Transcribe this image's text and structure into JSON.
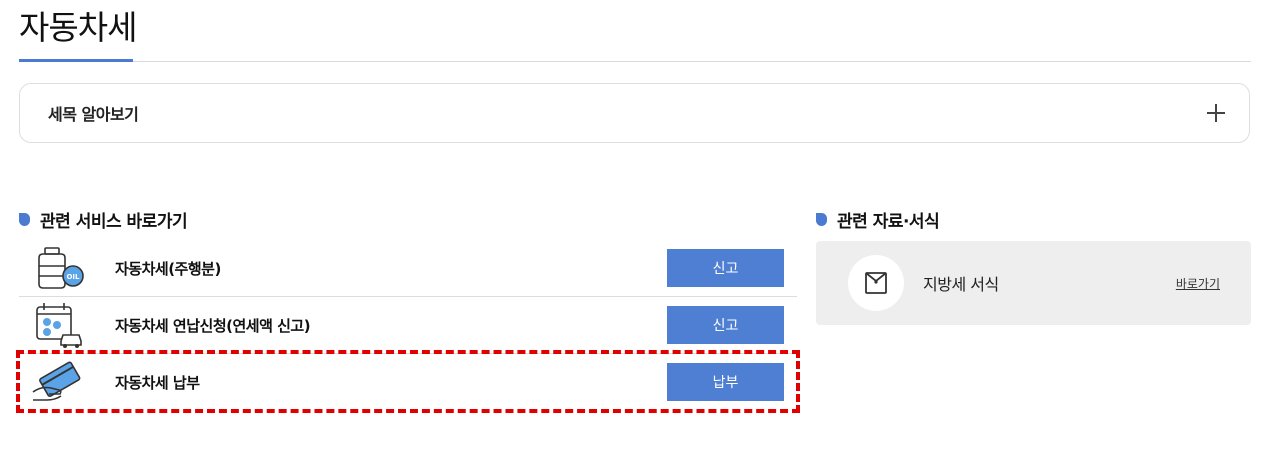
{
  "page": {
    "title": "자동차세"
  },
  "accordion": {
    "label": "세목 알아보기",
    "icon": "plus-icon"
  },
  "services": {
    "heading": "관련 서비스 바로가기",
    "items": [
      {
        "label": "자동차세(주행분)",
        "button": "신고",
        "icon": "oil-tank-icon"
      },
      {
        "label": "자동차세 연납신청(연세액 신고)",
        "button": "신고",
        "icon": "calendar-car-icon"
      },
      {
        "label": "자동차세 납부",
        "button": "납부",
        "icon": "card-payment-icon",
        "highlighted": true
      }
    ]
  },
  "documents": {
    "heading": "관련 자료·서식",
    "items": [
      {
        "title": "지방세 서식",
        "link": "바로가기",
        "icon": "envelope-icon"
      }
    ]
  },
  "colors": {
    "accent": "#4a7bd0",
    "button": "#4f7fd2",
    "highlight": "#e00000",
    "panel": "#eeeeee"
  }
}
